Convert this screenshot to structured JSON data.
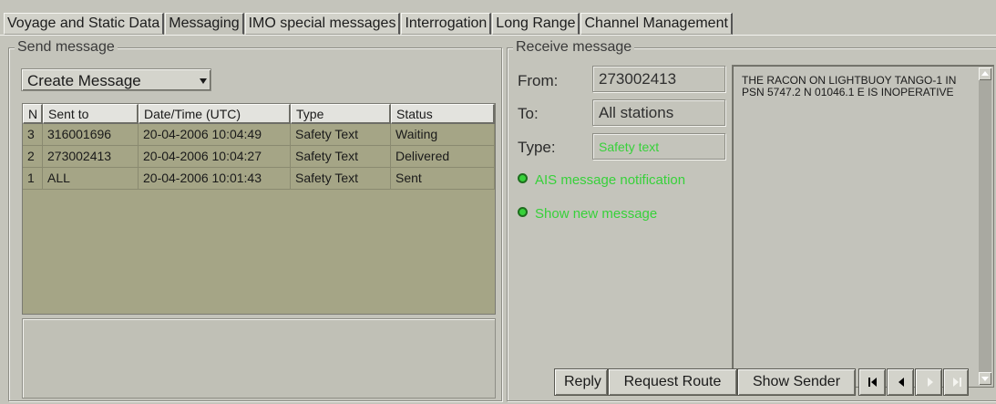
{
  "tabs": [
    {
      "label": "Voyage and Static Data",
      "active": false
    },
    {
      "label": "Messaging",
      "active": true
    },
    {
      "label": "IMO special messages",
      "active": false
    },
    {
      "label": "Interrogation",
      "active": false
    },
    {
      "label": "Long Range",
      "active": false
    },
    {
      "label": "Channel Management",
      "active": false
    }
  ],
  "send": {
    "legend": "Send message",
    "dropdown_value": "Create Message",
    "columns": [
      "N",
      "Sent to",
      "Date/Time (UTC)",
      "Type",
      "Status"
    ],
    "rows": [
      {
        "n": "3",
        "to": "316001696",
        "datetime": "20-04-2006 10:04:49",
        "type": "Safety Text",
        "status": "Waiting"
      },
      {
        "n": "2",
        "to": "273002413",
        "datetime": "20-04-2006 10:04:27",
        "type": "Safety Text",
        "status": "Delivered"
      },
      {
        "n": "1",
        "to": "ALL",
        "datetime": "20-04-2006 10:01:43",
        "type": "Safety Text",
        "status": "Sent"
      }
    ]
  },
  "receive": {
    "legend": "Receive message",
    "from_label": "From:",
    "from_value": "273002413",
    "to_label": "To:",
    "to_value": "All stations",
    "type_label": "Type:",
    "type_value": "Safety text",
    "option1": "AIS message notification",
    "option2": "Show new message",
    "message_text": "THE RACON ON LIGHTBUOY  TANGO-1 IN PSN 5747.2 N  01046.1 E IS INOPERATIVE",
    "buttons": {
      "reply": "Reply",
      "request_route": "Request Route",
      "show_sender": "Show Sender"
    }
  },
  "colors": {
    "accent_green": "#37d13a",
    "table_bg": "#a5a586",
    "panel_bg": "#c4c4bb"
  }
}
